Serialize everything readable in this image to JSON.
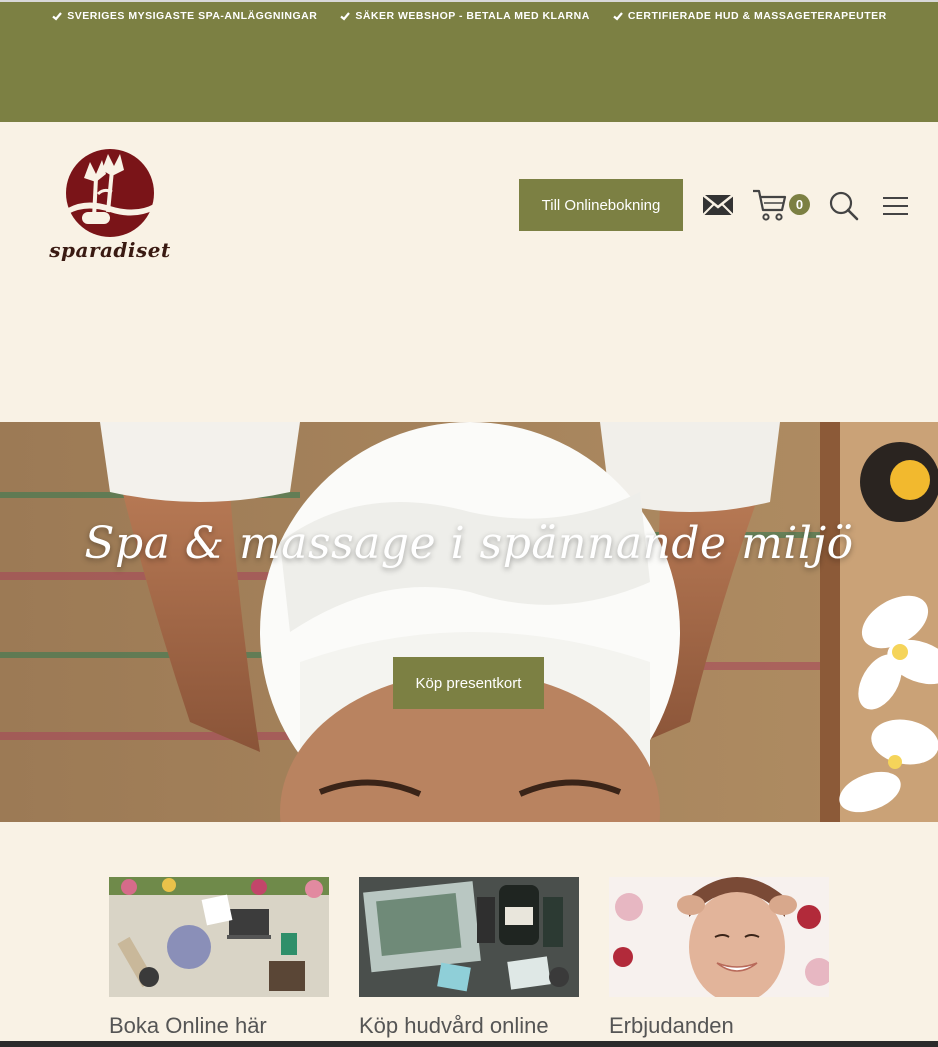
{
  "topbar": {
    "items": [
      {
        "label": "SVERIGES MYSIGASTE SPA-ANLÄGGNINGAR",
        "icon": "check-icon"
      },
      {
        "label": "SÄKER WEBSHOP - BETALA MED KLARNA",
        "icon": "check-icon"
      },
      {
        "label": "CERTIFIERADE HUD & MASSAGETERAPEUTER",
        "icon": "check-icon"
      }
    ],
    "background": "#7c8043"
  },
  "header": {
    "logo_text": "sparadiset",
    "booking_label": "Till Onlinebokning",
    "cart_count": "0",
    "icons": [
      "mail-icon",
      "cart-icon",
      "search-icon",
      "menu-icon"
    ]
  },
  "hero": {
    "title": "Spa & massage i spännande miljö",
    "button_label": "Köp presentkort"
  },
  "cards": [
    {
      "title": "Boka Online här"
    },
    {
      "title": "Köp hudvård online"
    },
    {
      "title": "Erbjudanden"
    }
  ],
  "colors": {
    "accent": "#7c8043",
    "page_bg": "#f9f2e5",
    "logo_red": "#7a1418"
  }
}
